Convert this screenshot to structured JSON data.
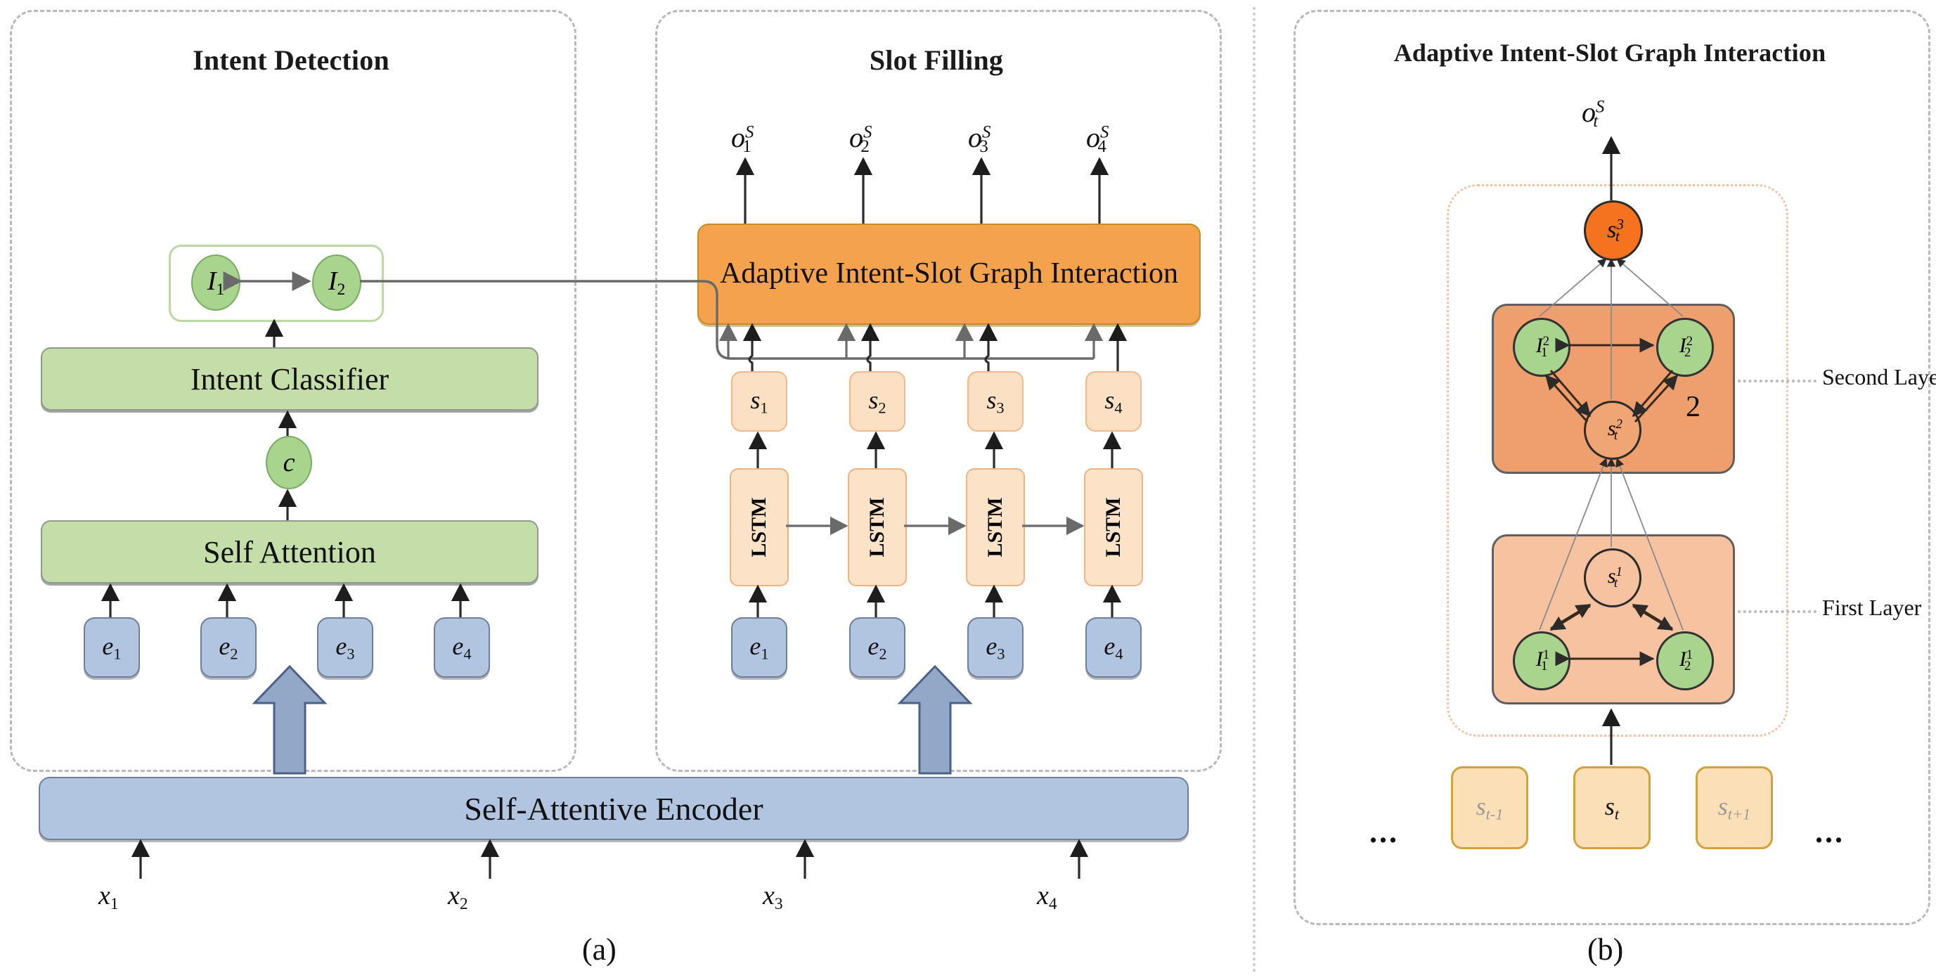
{
  "figure": {
    "panel_a_caption": "(a)",
    "panel_b_caption": "(b)"
  },
  "panels": {
    "intent_detection": {
      "title": "Intent Detection",
      "intent_nodes": [
        "I",
        "I"
      ],
      "intent_node_subs": [
        "1",
        "2"
      ],
      "intent_classifier_label": "Intent Classifier",
      "context_node": "c",
      "self_attention_label": "Self Attention",
      "embeddings": [
        "e",
        "e",
        "e",
        "e"
      ],
      "embedding_subs": [
        "1",
        "2",
        "3",
        "4"
      ]
    },
    "slot_filling": {
      "title": "Slot Filling",
      "outputs": [
        "o",
        "o",
        "o",
        "o"
      ],
      "output_subs": [
        "1",
        "2",
        "3",
        "4"
      ],
      "output_sups": [
        "S",
        "S",
        "S",
        "S"
      ],
      "interaction_label": "Adaptive Intent-Slot Graph Interaction",
      "slots": [
        "s",
        "s",
        "s",
        "s"
      ],
      "slot_subs": [
        "1",
        "2",
        "3",
        "4"
      ],
      "lstm_label": "LSTM",
      "lstm_count": 4,
      "embeddings": [
        "e",
        "e",
        "e",
        "e"
      ],
      "embedding_subs": [
        "1",
        "2",
        "3",
        "4"
      ]
    },
    "encoder": {
      "label": "Self-Attentive Encoder",
      "inputs": [
        "x",
        "x",
        "x",
        "x"
      ],
      "input_subs": [
        "1",
        "2",
        "3",
        "4"
      ]
    },
    "graph_interaction": {
      "title": "Adaptive Intent-Slot Graph Interaction",
      "output_node": "o",
      "output_sub": "t",
      "output_sup": "S",
      "top_node": "s",
      "top_node_sub": "t",
      "top_node_sup": "3",
      "second_layer": {
        "label": "Second Layer",
        "badge": "2",
        "intent_nodes": [
          "I",
          "I"
        ],
        "intent_subs": [
          "1",
          "2"
        ],
        "intent_sups": [
          "2",
          "2"
        ],
        "slot_node": "s",
        "slot_sub": "t",
        "slot_sup": "2"
      },
      "first_layer": {
        "label": "First Layer",
        "intent_nodes": [
          "I",
          "I"
        ],
        "intent_subs": [
          "1",
          "2"
        ],
        "intent_sups": [
          "1",
          "1"
        ],
        "slot_node": "s",
        "slot_sub": "t",
        "slot_sup": "1"
      },
      "tokens": {
        "left_ellipsis": "...",
        "right_ellipsis": "...",
        "prev": "s",
        "prev_sub": "t-1",
        "current": "s",
        "current_sub": "t",
        "next": "s",
        "next_sub": "t+1"
      }
    }
  },
  "colors": {
    "green_block": "#C4DDA9",
    "green_node": "#A9D48D",
    "blue_block": "#B2C5E0",
    "orange_block": "#F5A24E",
    "orange_node": "#F5721F",
    "peach_block": "#FBE0C4",
    "stage_orange": "#EF9F6D",
    "stage_light_orange": "#F6C2A0",
    "token_fill": "#FBDFB6",
    "token_border": "#D2A23C",
    "dashed_border": "#B9B9B9"
  }
}
